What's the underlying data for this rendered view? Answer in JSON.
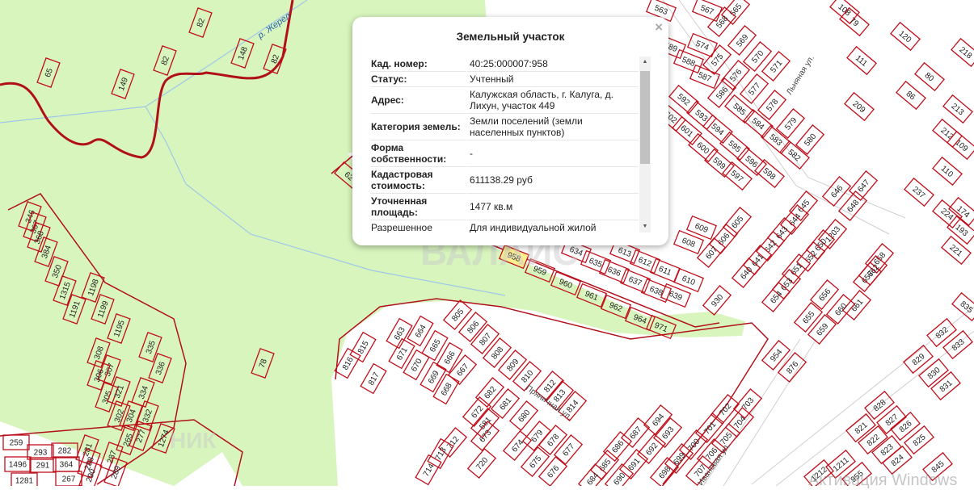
{
  "popup": {
    "title": "Земельный участок",
    "close_icon": "×",
    "rows": [
      {
        "key": "Кад. номер:",
        "value": "40:25:000007:958"
      },
      {
        "key": "Статус:",
        "value": "Учтенный"
      },
      {
        "key": "Адрес:",
        "value": "Калужская область, г. Калуга, д. Лихун, участок 449"
      },
      {
        "key": "Категория земель:",
        "value": "Земли поселений (земли населенных пунктов)"
      },
      {
        "key": "Форма собственности:",
        "value": "-"
      },
      {
        "key": "Кадастровая стоимость:",
        "value": "611138.29 руб"
      },
      {
        "key": "Уточненная площадь:",
        "value": "1477 кв.м"
      },
      {
        "key": "Разрешенное",
        "value": "Для индивидуальной жилой"
      }
    ]
  },
  "map": {
    "river_label": "р. Жерел",
    "street_labels": [
      "Льняная ул.",
      "Пряничная ул.",
      "Ивовая ул.",
      "Ивановая ул."
    ],
    "selected_parcel": "958",
    "colors": {
      "forest": "#d8f5bd",
      "parcel": "#c0101c",
      "selected": "#fbee8f",
      "river": "#9fc8e8"
    },
    "parcels": [
      "82",
      "148",
      "82",
      "82",
      "65",
      "149",
      "78",
      "346",
      "367",
      "368",
      "384",
      "350",
      "1315",
      "1191",
      "1198",
      "1199",
      "1195",
      "335",
      "336",
      "308",
      "307",
      "306",
      "305",
      "321",
      "304",
      "302",
      "334",
      "332",
      "265",
      "277",
      "1274",
      "259",
      "293",
      "282",
      "281",
      "291",
      "364",
      "288",
      "287",
      "290",
      "289",
      "267",
      "1281",
      "1496",
      "805",
      "806",
      "807",
      "808",
      "809",
      "810",
      "812",
      "813",
      "814",
      "663",
      "664",
      "671",
      "665",
      "670",
      "666",
      "669",
      "667",
      "668",
      "816",
      "815",
      "817",
      "959",
      "960",
      "961",
      "962",
      "964",
      "971",
      "930",
      "634",
      "635",
      "636",
      "637",
      "638",
      "639",
      "613",
      "612",
      "611",
      "610",
      "609",
      "605",
      "606",
      "608",
      "607",
      "645",
      "644",
      "643",
      "642",
      "641",
      "640",
      "646",
      "647",
      "648",
      "1203",
      "650",
      "652",
      "651",
      "653",
      "654",
      "658",
      "657",
      "662",
      "656",
      "655",
      "661",
      "660",
      "659",
      "954",
      "876",
      "672",
      "682",
      "581",
      "681",
      "673",
      "680",
      "674",
      "679",
      "675",
      "678",
      "676",
      "677",
      "712",
      "713",
      "714",
      "720",
      "703",
      "702",
      "701",
      "704",
      "700",
      "705",
      "699",
      "706",
      "707",
      "694",
      "693",
      "687",
      "686",
      "692",
      "685",
      "691",
      "698",
      "690",
      "684",
      "563",
      "567",
      "565",
      "568",
      "569",
      "570",
      "571",
      "574",
      "575",
      "576",
      "577",
      "578",
      "579",
      "580",
      "589",
      "588",
      "587",
      "586",
      "585",
      "584",
      "583",
      "582",
      "592",
      "593",
      "594",
      "595",
      "596",
      "597",
      "598",
      "601",
      "600",
      "599",
      "602",
      "62",
      "108",
      "79",
      "120",
      "218",
      "111",
      "80",
      "86",
      "209",
      "213",
      "212",
      "109",
      "110",
      "237",
      "224",
      "174",
      "193",
      "221",
      "835",
      "832",
      "833",
      "829",
      "830",
      "831",
      "828",
      "827",
      "826",
      "821",
      "822",
      "823",
      "825",
      "824",
      "845",
      "1211",
      "1212",
      "955"
    ]
  },
  "watermarks": {
    "brand": "ВАЛАИС",
    "bottom_left": "НИК",
    "bottom_right": "Активация Windows"
  }
}
